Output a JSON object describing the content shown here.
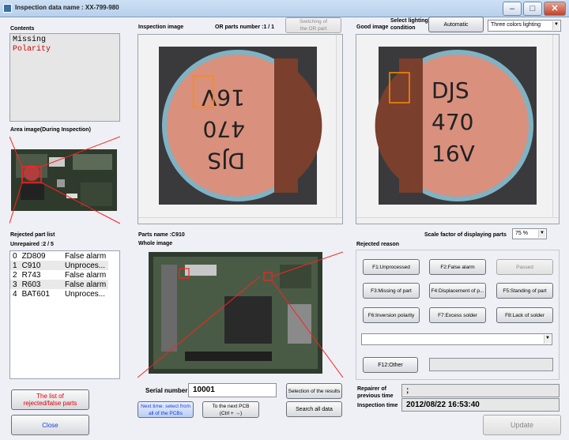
{
  "window": {
    "title": "Inspection data name : XX-799-980"
  },
  "contents": {
    "label": "Contents",
    "lines": [
      "Missing",
      "Polarity"
    ],
    "colors": [
      "#000000",
      "#d00000"
    ]
  },
  "area_image": {
    "label": "Area image(During Inspection)"
  },
  "rejected": {
    "label": "Rejected part list",
    "unrepaired": "Unrepaired :2 / 5",
    "rows": [
      [
        "0",
        "ZD809",
        "False alarm"
      ],
      [
        "1",
        "C910",
        "Unproces..."
      ],
      [
        "2",
        "R743",
        "False alarm"
      ],
      [
        "3",
        "R603",
        "False alarm"
      ],
      [
        "4",
        "BAT601",
        "Unproces..."
      ]
    ]
  },
  "left_buttons": {
    "list": "The list of\nrejected/false parts",
    "close": "Close"
  },
  "inspection_image": {
    "label": "Inspection image",
    "or_parts": "OR parts number :1 / 1",
    "switch_btn": "Switching of\nthe OR part",
    "chip_text": [
      "DJS",
      "470",
      "16V"
    ]
  },
  "good_image": {
    "label": "Good image",
    "lighting_label": "Select lighting\ncondition",
    "automatic_btn": "Automatic",
    "lighting_value": "Three colors lighting"
  },
  "parts_name": "Parts name :C910",
  "whole_image": {
    "label": "Whole image"
  },
  "scale": {
    "label": "Scale factor of displaying parts",
    "value": "75 %"
  },
  "serial": {
    "label": "Serial number",
    "value": "10001"
  },
  "nav_buttons": {
    "next_time": "Next time: select from\nall of the PCBs",
    "next_pcb": "To the next PCB\n(Ctrl + →)",
    "selection": "Selection of the results",
    "search": "Search all data"
  },
  "reason": {
    "label": "Rejected reason",
    "buttons": [
      "F1:Unprocessed",
      "F2:False alarm",
      "Passed",
      "F3:Missing of part",
      "F4:Displacement of p...",
      "F5:Standing of part",
      "F6:Inversion polarity",
      "F7:Excess solder",
      "F8:Lack of solder"
    ],
    "f12": "F12:Other"
  },
  "repairer": {
    "label": "Repairer of\nprevious time",
    "value": ";"
  },
  "inspection_time": {
    "label": "Inspection time",
    "value": "2012/08/22 16:53:40"
  },
  "update_btn": "Update",
  "icons": {
    "minimize": "minimize-icon",
    "maximize": "maximize-icon",
    "close": "close-icon"
  }
}
